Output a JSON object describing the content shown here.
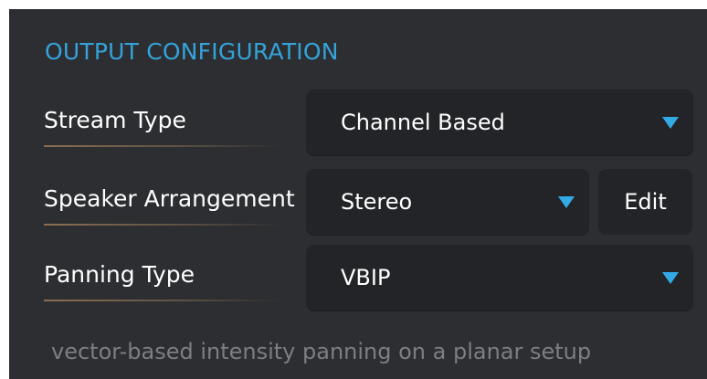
{
  "section": {
    "title": "OUTPUT CONFIGURATION"
  },
  "rows": [
    {
      "label": "Stream Type",
      "value": "Channel Based"
    },
    {
      "label": "Speaker Arrangement",
      "value": "Stereo",
      "edit_label": "Edit"
    },
    {
      "label": "Panning Type",
      "value": "VBIP"
    }
  ],
  "description": "vector-based intensity panning on a planar setup",
  "colors": {
    "panel_background": "#2c2e32",
    "control_background": "#222427",
    "accent": "#33a9e6",
    "title": "#35a2d8",
    "description_text": "#7c7e82"
  },
  "icons": {
    "dropdown_arrow": "caret-down-icon"
  }
}
